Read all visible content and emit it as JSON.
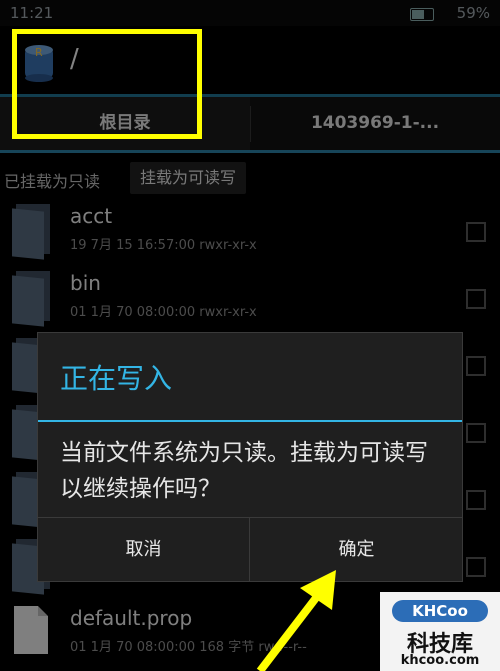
{
  "status_bar": {
    "time": "11:21",
    "battery": "59%"
  },
  "header": {
    "path": "/"
  },
  "tabs": [
    {
      "label": "根目录"
    },
    {
      "label": "1403969-1-..."
    }
  ],
  "mount": {
    "status": "已挂载为只读",
    "button_label": "挂载为可读写"
  },
  "files": [
    {
      "name": "acct",
      "meta": "19 7月 15 16:57:00    rwxr-xr-x"
    },
    {
      "name": "bin",
      "meta": "01 1月 70 08:00:00    rwxr-xr-x"
    },
    {
      "name": "default.prop",
      "meta": "01 1月 70 08:00:00  168 字节  rw-r--r--"
    }
  ],
  "dialog": {
    "title": "正在写入",
    "message": "当前文件系统为只读。挂载为可读写以继续操作吗？",
    "cancel_label": "取消",
    "ok_label": "确定"
  },
  "watermark": {
    "logo": "KHCoo",
    "title": "科技库",
    "url": "khcoo.com"
  },
  "colors": {
    "accent": "#33b5e5",
    "highlight": "#ffff00",
    "tab_underline": "#2b7fa3"
  }
}
